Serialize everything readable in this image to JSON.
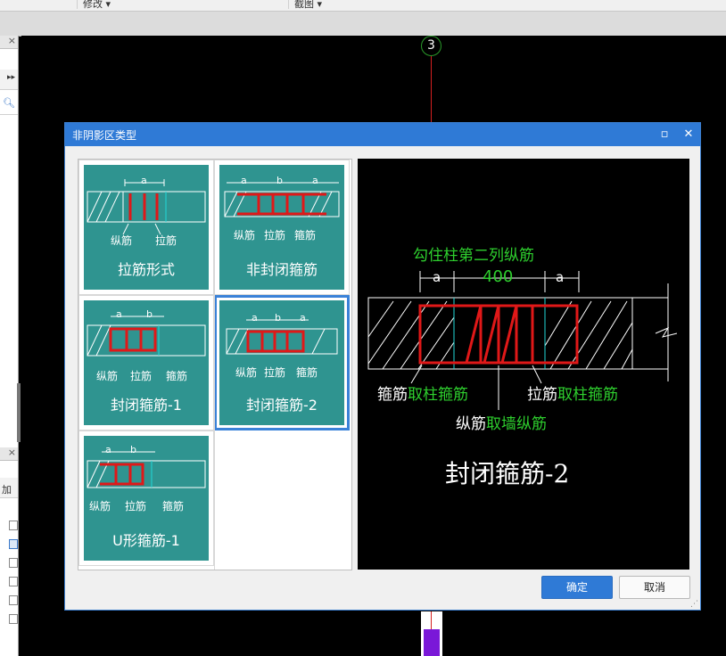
{
  "app": {
    "toolbar_items": [
      "修改 ▾",
      "截图 ▾"
    ],
    "axis_label": "3"
  },
  "left_panel": {
    "search_icon": "magnifier-icon",
    "expand_icon": "double-chevron-right-icon",
    "row_text": "加"
  },
  "dialog": {
    "title": "非阴影区类型",
    "maximize_icon": "maximize-icon",
    "close_icon": "close-icon",
    "tiles": [
      {
        "label": "拉筋形式",
        "dims": [
          "a"
        ],
        "bars": [
          "纵筋",
          "拉筋"
        ]
      },
      {
        "label": "非封闭箍筋",
        "dims": [
          "a",
          "b",
          "a"
        ],
        "bars": [
          "纵筋",
          "拉筋",
          "箍筋"
        ]
      },
      {
        "label": "封闭箍筋-1",
        "dims": [
          "a",
          "b"
        ],
        "bars": [
          "纵筋",
          "拉筋",
          "箍筋"
        ]
      },
      {
        "label": "封闭箍筋-2",
        "dims": [
          "a",
          "b",
          "a"
        ],
        "bars": [
          "纵筋",
          "拉筋",
          "箍筋"
        ]
      },
      {
        "label": "U形箍筋-1",
        "dims": [
          "a",
          "b"
        ],
        "bars": [
          "纵筋",
          "拉筋",
          "箍筋"
        ]
      }
    ],
    "selected_index": 3,
    "preview": {
      "top_note": "勾住柱第二列纵筋",
      "dim_a": "a",
      "dim_mid": "400",
      "stirrup_prefix": "箍筋",
      "stirrup_rule": "取柱箍筋",
      "tie_prefix": "拉筋",
      "tie_rule": "取柱箍筋",
      "long_prefix": "纵筋",
      "long_rule": "取墙纵筋",
      "title": "封闭箍筋-2"
    },
    "ok_label": "确定",
    "cancel_label": "取消",
    "colors": {
      "tile_bg": "#2f9490",
      "accent": "#2f7ad6",
      "rebar_red": "#e01818",
      "note_green": "#2ecf2e"
    }
  }
}
